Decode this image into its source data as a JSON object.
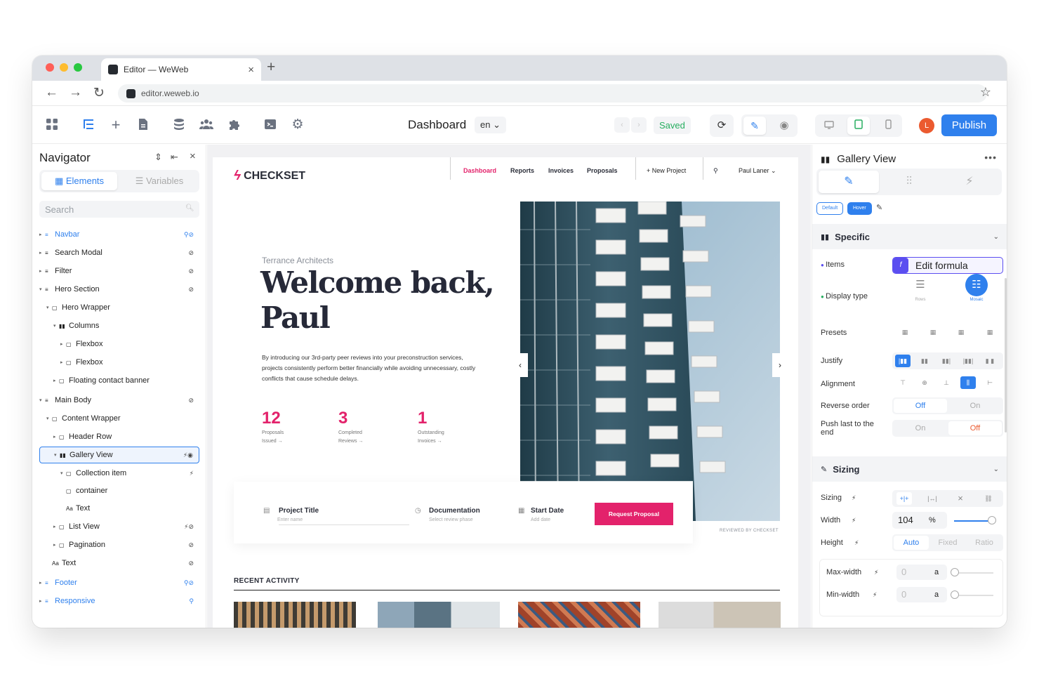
{
  "browser": {
    "tab_title": "Editor — WeWeb",
    "tab_close": "×",
    "new_tab": "+",
    "url": "editor.weweb.io"
  },
  "toolbar": {
    "page_title": "Dashboard",
    "language": "en ⌄",
    "status": "Saved",
    "avatar_initial": "L",
    "publish_label": "Publish"
  },
  "navigator": {
    "title": "Navigator",
    "tabs": [
      "Elements",
      "Variables"
    ],
    "search_placeholder": "Search",
    "items": [
      {
        "label": "Navbar",
        "indent": 0,
        "icon": "≡",
        "blue": true,
        "caret": "▸",
        "flag": "⚲⊘"
      },
      {
        "label": "Search Modal",
        "indent": 0,
        "icon": "≡",
        "caret": "▸",
        "flag": "⊘"
      },
      {
        "label": "Filter",
        "indent": 0,
        "icon": "≡",
        "caret": "▸",
        "flag": "⊘"
      },
      {
        "label": "Hero Section",
        "indent": 0,
        "icon": "≡",
        "caret": "▾",
        "flag": "⊘"
      },
      {
        "label": "Hero Wrapper",
        "indent": 1,
        "icon": "▢",
        "caret": "▾",
        "flag": ""
      },
      {
        "label": "Columns",
        "indent": 2,
        "icon": "▮▮",
        "caret": "▾",
        "flag": ""
      },
      {
        "label": "Flexbox",
        "indent": 3,
        "icon": "▢",
        "caret": "▸",
        "flag": ""
      },
      {
        "label": "Flexbox",
        "indent": 3,
        "icon": "▢",
        "caret": "▸",
        "flag": ""
      },
      {
        "label": "Floating contact banner",
        "indent": 2,
        "icon": "▢",
        "caret": "▸",
        "flag": ""
      },
      {
        "label": "Main Body",
        "indent": 0,
        "icon": "≡",
        "caret": "▾",
        "flag": "⊘"
      },
      {
        "label": "Content Wrapper",
        "indent": 1,
        "icon": "▢",
        "caret": "▾",
        "flag": ""
      },
      {
        "label": "Header Row",
        "indent": 2,
        "icon": "▢",
        "caret": "▸",
        "flag": ""
      },
      {
        "label": "Gallery View",
        "indent": 2,
        "icon": "▮▮",
        "caret": "▾",
        "flag": "⚡◉",
        "selected": true
      },
      {
        "label": "Collection item",
        "indent": 3,
        "icon": "▢",
        "caret": "▾",
        "flag": "⚡"
      },
      {
        "label": "container",
        "indent": 3,
        "icon": "▢",
        "caret": "",
        "flag": ""
      },
      {
        "label": "Text",
        "indent": 3,
        "icon": "Aa",
        "caret": "",
        "flag": ""
      },
      {
        "label": "List View",
        "indent": 2,
        "icon": "▢",
        "caret": "▸",
        "flag": "⚡⊘"
      },
      {
        "label": "Pagination",
        "indent": 2,
        "icon": "▢",
        "caret": "▸",
        "flag": "⊘"
      },
      {
        "label": "Text",
        "indent": 1,
        "icon": "Aa",
        "caret": "",
        "flag": "⊘"
      },
      {
        "label": "Footer",
        "indent": 0,
        "icon": "≡",
        "blue": true,
        "caret": "▸",
        "flag": "⚲⊘"
      },
      {
        "label": "Responsive",
        "indent": 0,
        "icon": "≡",
        "blue": true,
        "caret": "▸",
        "flag": "⚲"
      }
    ]
  },
  "site": {
    "brand": "CHECKSET",
    "nav": [
      "Dashboard",
      "Reports",
      "Invoices",
      "Proposals"
    ],
    "new_project": "+ New Project",
    "user": "Paul Laner ⌄",
    "eyebrow": "Terrance Architects",
    "headline_1": "Welcome back,",
    "headline_2": "Paul",
    "lead": "By introducing our 3rd-party peer reviews into your preconstruction services, projects consistently perform better financially while avoiding unnecessary, costly conflicts that cause schedule delays.",
    "stats": [
      {
        "value": "12",
        "l1": "Proposals",
        "l2": "Issued →"
      },
      {
        "value": "3",
        "l1": "Completed",
        "l2": "Reviews →"
      },
      {
        "value": "1",
        "l1": "Outstanding",
        "l2": "Invoices →"
      }
    ],
    "form": {
      "f1_title": "Project Title",
      "f1_sub": "Enter name",
      "f2_title": "Documentation",
      "f2_sub": "Select review phase",
      "f3_title": "Start Date",
      "f3_sub": "Add date",
      "button": "Request Proposal"
    },
    "reviewed": "REVIEWED BY CHECKSET",
    "recent": "RECENT ACTIVITY"
  },
  "panel": {
    "title": "Gallery View",
    "states": [
      "Default",
      "Hover"
    ],
    "specific": "Specific",
    "items_label": "Items",
    "formula_label": "Edit formula",
    "display_type_label": "Display type",
    "display_options": [
      "Rows",
      "Mosaic"
    ],
    "presets_label": "Presets",
    "justify_label": "Justify",
    "alignment_label": "Alignment",
    "reverse_label": "Reverse order",
    "reverse_opts": [
      "Off",
      "On"
    ],
    "push_label": "Push last to the end",
    "push_opts": [
      "On",
      "Off"
    ],
    "sizing_section": "Sizing",
    "sizing_label": "Sizing",
    "width_label": "Width",
    "width_value": "104",
    "width_unit": "%",
    "width_fill": 0.9,
    "height_label": "Height",
    "height_opts": [
      "Auto",
      "Fixed",
      "Ratio"
    ],
    "maxw_label": "Max-width",
    "minw_label": "Min-width",
    "maxw_value": "0",
    "minw_value": "0",
    "auto_unit": "a"
  },
  "colors": {
    "accent": "#2f80ed",
    "brand": "#e3226b",
    "saved": "#27ae60",
    "formula": "#5b4ef0"
  }
}
